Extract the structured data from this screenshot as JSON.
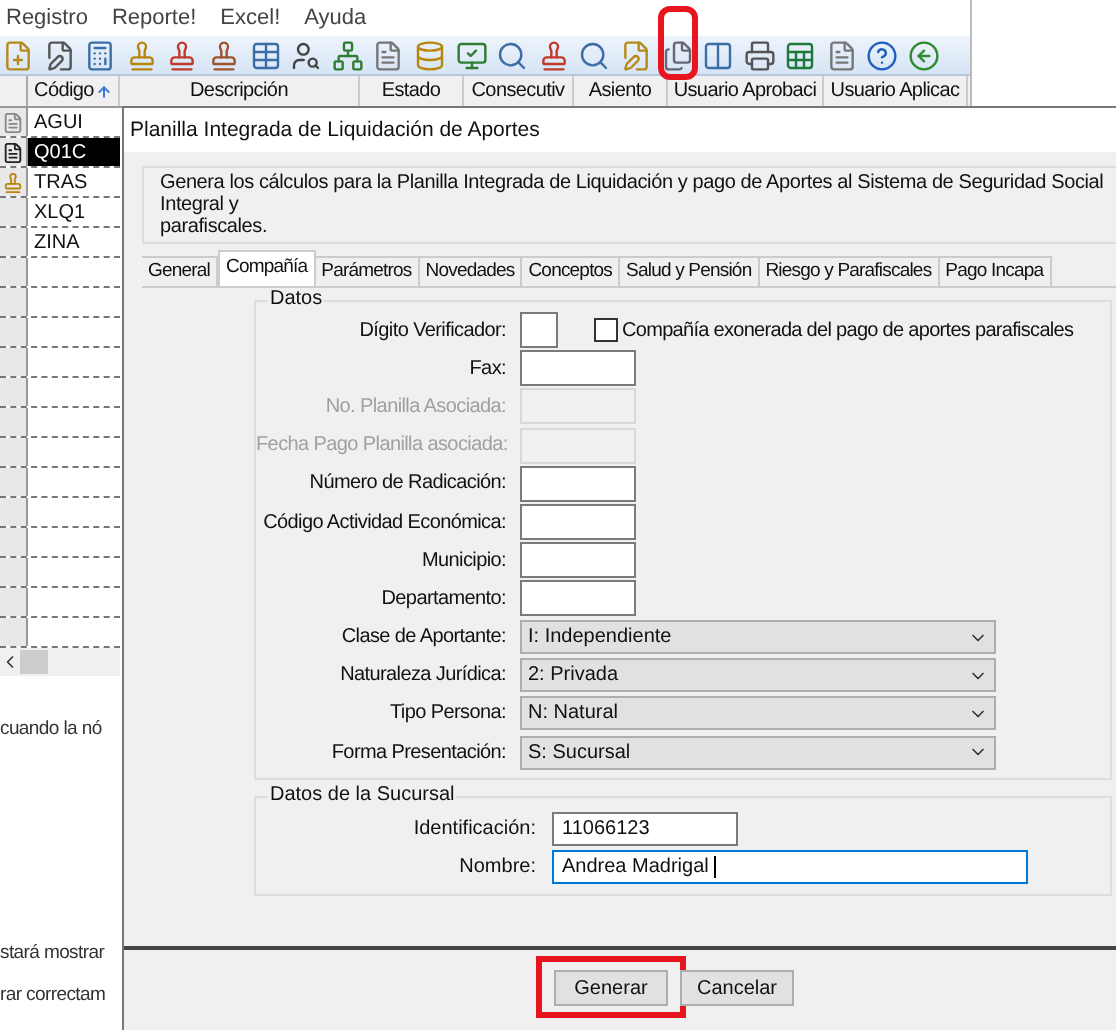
{
  "menu": [
    "Registro",
    "Reporte!",
    "Excel!",
    "Ayuda"
  ],
  "grid": {
    "columns": [
      {
        "label": "Código",
        "sorted": true
      },
      {
        "label": "Descripción",
        "sorted": false
      },
      {
        "label": "Estado",
        "sorted": false
      },
      {
        "label": "Consecutiv",
        "sorted": false
      },
      {
        "label": "Asiento",
        "sorted": false
      },
      {
        "label": "Usuario Aprobaci",
        "sorted": false
      },
      {
        "label": "Usuario Aplicac",
        "sorted": false
      }
    ],
    "rows": [
      {
        "code": "AGUI",
        "kind": "document",
        "selected": false
      },
      {
        "code": "Q01C",
        "kind": "document",
        "selected": true
      },
      {
        "code": "TRAS",
        "kind": "stamped",
        "selected": false
      },
      {
        "code": "XLQ1",
        "kind": "plain",
        "selected": false
      },
      {
        "code": "ZINA",
        "kind": "plain",
        "selected": false
      }
    ]
  },
  "background_text": [
    "cuando la nó",
    "stará mostrar",
    "rar correctam"
  ],
  "dialog": {
    "title": "Planilla Integrada de Liquidación de Aportes",
    "description": [
      "Genera los cálculos para la Planilla Integrada de Liquidación y pago de Aportes al Sistema de Seguridad Social Integral y",
      "parafiscales."
    ],
    "tabs": [
      {
        "label": "General",
        "selected": false
      },
      {
        "label": "Compañía",
        "selected": true
      },
      {
        "label": "Parámetros",
        "selected": false
      },
      {
        "label": "Novedades",
        "selected": false
      },
      {
        "label": "Conceptos",
        "selected": false
      },
      {
        "label": "Salud y Pensión",
        "selected": false
      },
      {
        "label": "Riesgo y Parafiscales",
        "selected": false
      },
      {
        "label": "Pago Incapa",
        "selected": false
      }
    ],
    "datos": {
      "title": "Datos",
      "checkbox": {
        "label": "Compañía exonerada del pago de aportes parafiscales",
        "checked": false
      },
      "fields": [
        {
          "label": "Dígito Verificador:",
          "kind": "short",
          "disabled": false
        },
        {
          "label": "Fax:",
          "kind": "input",
          "disabled": false
        },
        {
          "label": "No. Planilla Asociada:",
          "kind": "input",
          "disabled": true
        },
        {
          "label": "Fecha Pago Planilla asociada:",
          "kind": "input",
          "disabled": true
        },
        {
          "label": "Número de Radicación:",
          "kind": "input",
          "disabled": false
        },
        {
          "label": "Código Actividad Económica:",
          "kind": "input",
          "disabled": false
        },
        {
          "label": "Municipio:",
          "kind": "input",
          "disabled": false
        },
        {
          "label": "Departamento:",
          "kind": "input",
          "disabled": false
        },
        {
          "label": "Clase de Aportante:",
          "kind": "select",
          "value": "I: Independiente",
          "disabled": false
        },
        {
          "label": "Naturaleza Jurídica:",
          "kind": "select",
          "value": "2: Privada",
          "disabled": false
        },
        {
          "label": "Tipo Persona:",
          "kind": "select",
          "value": "N: Natural",
          "disabled": false
        },
        {
          "label": "Forma Presentación:",
          "kind": "select",
          "value": "S: Sucursal",
          "disabled": false
        }
      ]
    },
    "sucursal": {
      "title": "Datos de la Sucursal",
      "fields": [
        {
          "label": "Identificación:",
          "value": "11066123",
          "focused": false
        },
        {
          "label": "Nombre:",
          "value": "Andrea Madrigal",
          "focused": true
        }
      ]
    },
    "buttons": [
      {
        "label": "Generar",
        "highlighted": true
      },
      {
        "label": "Cancelar",
        "highlighted": false
      }
    ]
  }
}
